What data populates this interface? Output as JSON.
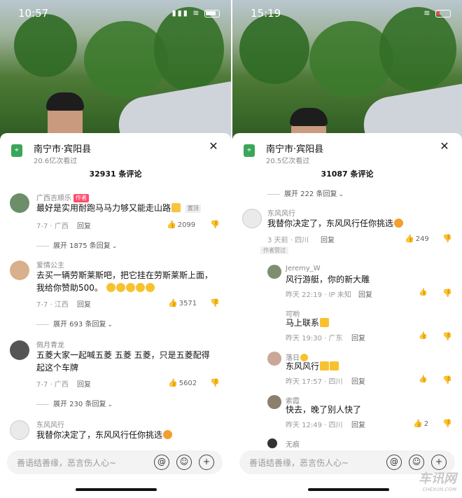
{
  "left": {
    "status_time": "10:57",
    "location": "南宁市·宾阳县",
    "views": "20.6亿次看过",
    "comment_count": "32931 条评论",
    "comments": [
      {
        "user": "广西吉顺乐",
        "tag": "作者",
        "text": "最好是实用耐跑马马力够又能走山路",
        "badge": "置顶",
        "meta": "7-7 · 广西",
        "reply": "回复",
        "likes": "2099",
        "expand": "展开 1875 条回复"
      },
      {
        "user": "爱情公主",
        "text": "去买一辆劳斯莱斯吧，把它挂在劳斯莱斯上面，我给你赞助500。",
        "meta": "7-7 · 江西",
        "reply": "回复",
        "likes": "3571",
        "expand": "展开 693 条回复"
      },
      {
        "user": "佩月青龙",
        "text": "五菱大家一起喊五菱 五菱 五菱，只是五菱配得起这个车牌",
        "meta": "7-7 · 广西",
        "reply": "回复",
        "likes": "5602",
        "expand": "展开 230 条回复"
      },
      {
        "user": "东风风行",
        "text": "我替你决定了，东风风行任你挑选"
      }
    ],
    "input_placeholder": "善语结善缘，恶言伤人心~"
  },
  "right": {
    "status_time": "15:19",
    "location": "南宁市·宾阳县",
    "views": "20.5亿次看过",
    "comment_count": "31087 条评论",
    "top_expand": "展开 222 条回复",
    "main_comment": {
      "user": "东风风行",
      "text": "我替你决定了，东风风行任你挑选",
      "meta": "3 天前 · 四川",
      "reply": "回复",
      "likes": "249",
      "badge": "作者赞过"
    },
    "replies": [
      {
        "user": "Jeremy_W",
        "text": "风行游艇，你的新大雕",
        "meta": "昨天 22:19 · IP 未知",
        "reply": "回复",
        "likes": ""
      },
      {
        "user": "可哟",
        "text": "马上联系",
        "meta": "昨天 19:30 · 广东",
        "reply": "回复",
        "likes": ""
      },
      {
        "user": "落日",
        "text": "东风风行",
        "meta": "昨天 17:57 · 四川",
        "reply": "回复",
        "likes": ""
      },
      {
        "user": "索霞",
        "text": "快去，晚了别人快了",
        "meta": "昨天 12:49 · 四川",
        "reply": "回复",
        "likes": "2"
      },
      {
        "user": "无痕",
        "text": ""
      }
    ],
    "input_placeholder": "善语结善缘，恶言伤人心~"
  },
  "watermark": "车讯网",
  "watermark_sub": "CHEXUN.COM",
  "icons": {
    "close": "close-icon",
    "like": "thumb-up-icon",
    "dislike": "thumb-down-icon",
    "at": "at-icon",
    "emoji": "emoji-icon",
    "add": "add-icon",
    "location": "location-pin-icon"
  },
  "colors": {
    "location_pin": "#3aa65a",
    "author_tag": "#ff4d6d"
  }
}
